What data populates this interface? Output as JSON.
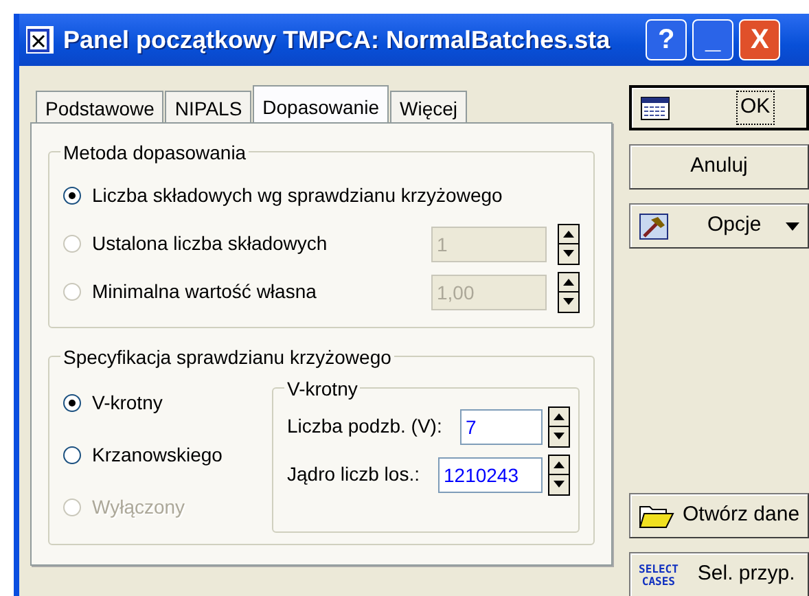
{
  "window": {
    "title": "Panel początkowy TMPCA: NormalBatches.sta",
    "controls": [
      "?",
      "_",
      "X"
    ]
  },
  "tabs": [
    {
      "label": "Podstawowe",
      "selected": false
    },
    {
      "label": "NIPALS",
      "selected": false
    },
    {
      "label": "Dopasowanie",
      "selected": true
    },
    {
      "label": "Więcej",
      "selected": false
    }
  ],
  "method_group": {
    "title": "Metoda dopasowania",
    "options": [
      {
        "label": "Liczba składowych wg sprawdzianu krzyżowego",
        "selected": true
      },
      {
        "label": "Ustalona liczba składowych",
        "selected": false,
        "value": "1",
        "disabled": true
      },
      {
        "label": "Minimalna wartość własna",
        "selected": false,
        "value": "1,00",
        "disabled": true
      }
    ]
  },
  "cv_group": {
    "title": "Specyfikacja sprawdzianu krzyżowego",
    "options": [
      {
        "label": "V-krotny",
        "selected": true,
        "disabled": false
      },
      {
        "label": "Krzanowskiego",
        "selected": false,
        "disabled": false
      },
      {
        "label": "Wyłączony",
        "selected": false,
        "disabled": true
      }
    ],
    "vfold": {
      "title": "V-krotny",
      "fields": [
        {
          "label": "Liczba podzb. (V):",
          "value": "7"
        },
        {
          "label": "Jądro liczb los.:",
          "value": "1210243"
        }
      ]
    }
  },
  "buttons": [
    {
      "kind": "ok",
      "label": "OK"
    },
    {
      "kind": "plain",
      "label": "Anuluj"
    },
    {
      "kind": "options",
      "label": "Opcje"
    },
    {
      "kind": "spacer"
    },
    {
      "kind": "open",
      "label": "Otwórz dane"
    },
    {
      "kind": "select",
      "label": "Sel. przyp.",
      "icon_text": [
        "SELECT",
        "CASES"
      ]
    }
  ]
}
